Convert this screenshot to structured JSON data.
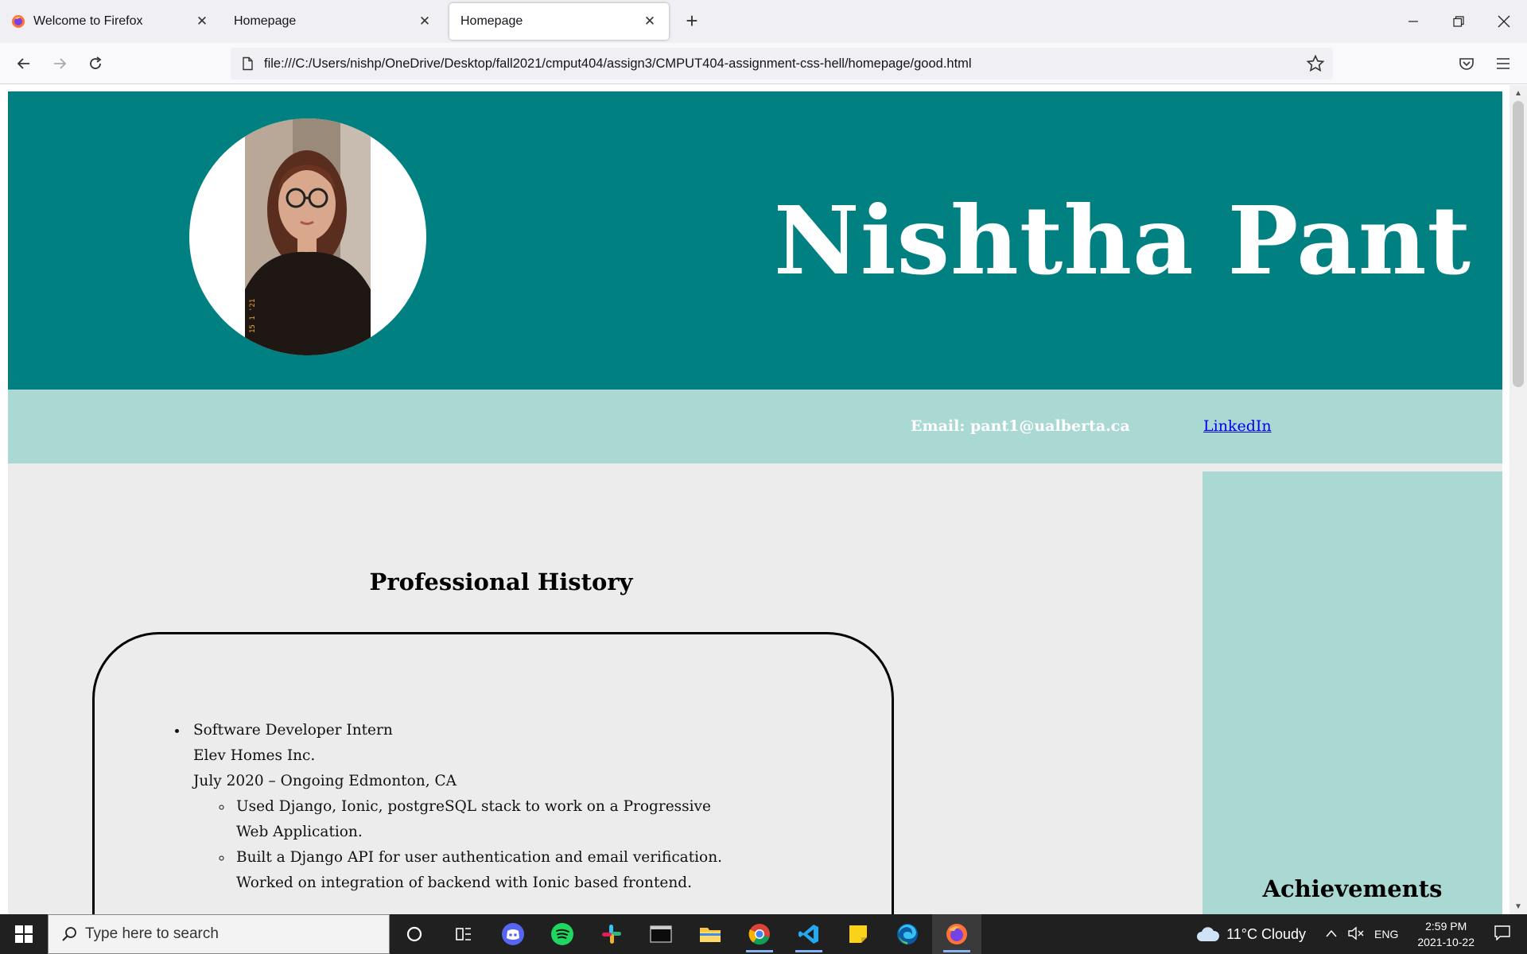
{
  "browser": {
    "tabs": [
      {
        "title": "Welcome to Firefox",
        "active": false
      },
      {
        "title": "Homepage",
        "active": false
      },
      {
        "title": "Homepage",
        "active": true
      }
    ],
    "url": "file:///C:/Users/nishp/OneDrive/Desktop/fall2021/cmput404/assign3/CMPUT404-assignment-css-hell/homepage/good.html"
  },
  "page": {
    "name": "Nishtha Pant",
    "email_label": "Email: pant1@ualberta.ca",
    "linkedin_label": "LinkedIn",
    "section_title": "Professional History",
    "sidebar_title": "Achievements",
    "jobs": [
      {
        "title": "Software Developer Intern",
        "company": "Elev Homes Inc.",
        "dates": "July 2020 – Ongoing Edmonton, CA",
        "bullets": [
          "Used Django, Ionic, postgreSQL stack to work on a Progressive Web Application.",
          "Built a Django API for user authentication and email verification. Worked on integration of backend with Ionic based frontend."
        ]
      }
    ],
    "photo_stamp": "15 1 '21",
    "colors": {
      "header": "#008080",
      "contact_bar": "#aad8d3",
      "sidebar": "#aad8d3",
      "page_bg": "#ececec"
    }
  },
  "taskbar": {
    "search_placeholder": "Type here to search",
    "weather": "11°C  Cloudy",
    "language": "ENG",
    "time": "2:59 PM",
    "date": "2021-10-22",
    "apps": [
      "cortana-icon",
      "task-view-icon",
      "discord-icon",
      "spotify-icon",
      "slack-icon",
      "terminal-icon",
      "file-explorer-icon",
      "chrome-icon",
      "vscode-icon",
      "sticky-notes-icon",
      "edge-icon",
      "firefox-icon"
    ]
  }
}
